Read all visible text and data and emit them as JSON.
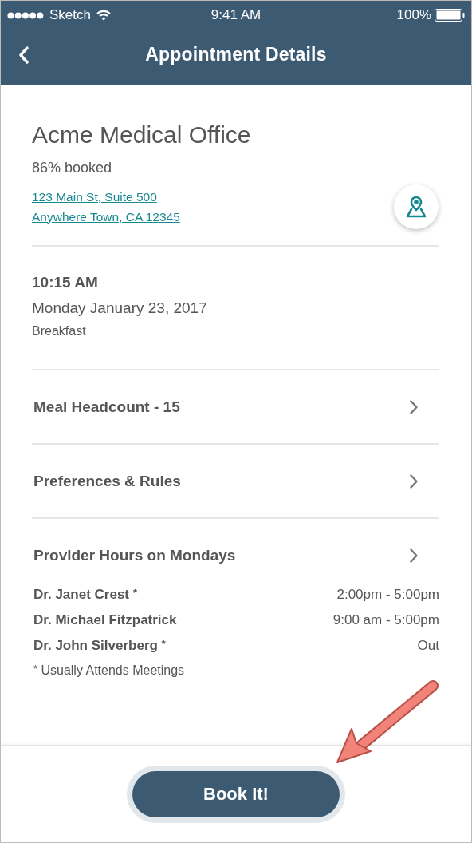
{
  "status_bar": {
    "carrier": "Sketch",
    "time": "9:41 AM",
    "battery": "100%"
  },
  "nav": {
    "title": "Appointment Details"
  },
  "office": {
    "name": "Acme Medical Office",
    "booked": "86% booked",
    "address_lines": [
      "123 Main St, Suite 500",
      "Anywhere Town, CA 12345"
    ]
  },
  "appointment": {
    "time": "10:15 AM",
    "date": "Monday January 23, 2017",
    "meal": "Breakfast"
  },
  "rows": [
    {
      "label": "Meal Headcount - 15"
    },
    {
      "label": "Preferences & Rules"
    },
    {
      "label": "Provider Hours on Mondays"
    }
  ],
  "providers": [
    {
      "name": "Dr. Janet Crest $^{*}$",
      "hours": "2:00pm - 5:00pm"
    },
    {
      "name": "Dr. Michael Fitzpatrick",
      "hours": "9:00 am - 5:00pm"
    },
    {
      "name": "Dr. John Silverberg $^{*}$",
      "hours": "Out"
    }
  ],
  "footnote": "$^{*}$ Usually Attends Meetings",
  "book_button": "Book It!"
}
